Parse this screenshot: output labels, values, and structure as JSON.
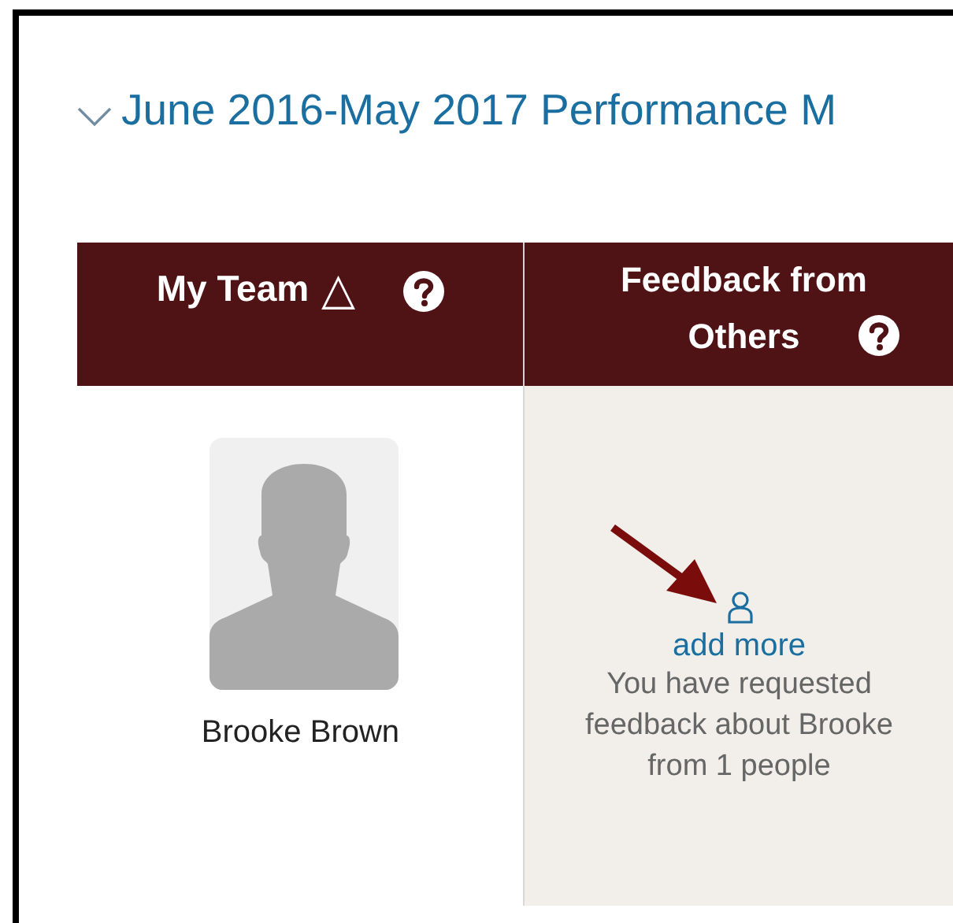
{
  "section": {
    "title": "June 2016-May 2017 Performance M",
    "expanded": true
  },
  "table": {
    "columns": [
      {
        "label": "My Team",
        "sort_indicator": "△",
        "help": true
      },
      {
        "label": "Feedback from Others",
        "help": true
      }
    ],
    "rows": [
      {
        "name": "Brooke Brown",
        "feedback": {
          "link": "add more",
          "note": "You have requested feedback about Brooke from 1 people"
        }
      }
    ]
  }
}
